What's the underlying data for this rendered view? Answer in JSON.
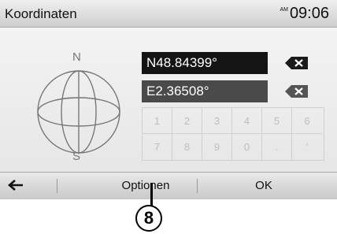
{
  "header": {
    "title": "Koordinaten",
    "ampm": "AM",
    "time": "09:06"
  },
  "globe": {
    "north": "N",
    "south": "S"
  },
  "fields": {
    "latitude": "N48.84399°",
    "longitude": "E2.36508°"
  },
  "keypad": {
    "row1": [
      "1",
      "2",
      "3",
      "4",
      "5",
      "6"
    ],
    "row2": [
      "7",
      "8",
      "9",
      "0",
      ".",
      "'"
    ]
  },
  "footer": {
    "options_label": "Optionen",
    "ok_label": "OK"
  },
  "callout": {
    "number": "8"
  },
  "icons": {
    "back": "back-arrow-icon",
    "delete": "backspace-icon"
  }
}
